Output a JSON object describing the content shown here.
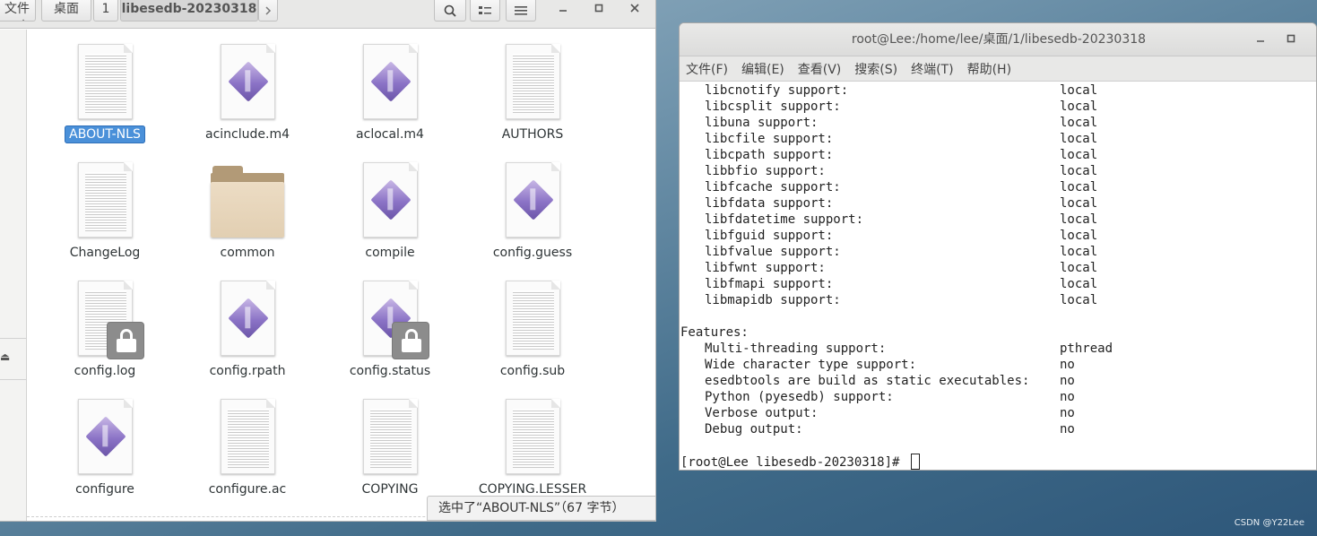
{
  "file_manager": {
    "breadcrumbs": [
      {
        "label": "文件夹"
      },
      {
        "label": "桌面"
      },
      {
        "label": "1"
      },
      {
        "label": "libesedb-20230318"
      }
    ],
    "items": [
      {
        "name": "ABOUT-NLS",
        "type": "text",
        "selected": true
      },
      {
        "name": "acinclude.m4",
        "type": "script"
      },
      {
        "name": "aclocal.m4",
        "type": "script"
      },
      {
        "name": "AUTHORS",
        "type": "text"
      },
      {
        "name": "ChangeLog",
        "type": "text"
      },
      {
        "name": "common",
        "type": "folder"
      },
      {
        "name": "compile",
        "type": "script"
      },
      {
        "name": "config.guess",
        "type": "script"
      },
      {
        "name": "config.log",
        "type": "text",
        "locked": true
      },
      {
        "name": "config.rpath",
        "type": "script"
      },
      {
        "name": "config.status",
        "type": "script",
        "locked": true
      },
      {
        "name": "config.sub",
        "type": "text"
      },
      {
        "name": "configure",
        "type": "script"
      },
      {
        "name": "configure.ac",
        "type": "text"
      },
      {
        "name": "COPYING",
        "type": "text"
      },
      {
        "name": "COPYING.LESSER",
        "type": "text"
      }
    ],
    "status": "选中了“ABOUT-NLS”（67 字节）"
  },
  "terminal": {
    "title": "root@Lee:/home/lee/桌面/1/libesedb-20230318",
    "menu": [
      "文件(F)",
      "编辑(E)",
      "查看(V)",
      "搜索(S)",
      "终端(T)",
      "帮助(H)"
    ],
    "lines": [
      {
        "key": "libcnotify support:",
        "value": "local"
      },
      {
        "key": "libcsplit support:",
        "value": "local"
      },
      {
        "key": "libuna support:",
        "value": "local"
      },
      {
        "key": "libcfile support:",
        "value": "local"
      },
      {
        "key": "libcpath support:",
        "value": "local"
      },
      {
        "key": "libbfio support:",
        "value": "local"
      },
      {
        "key": "libfcache support:",
        "value": "local"
      },
      {
        "key": "libfdata support:",
        "value": "local"
      },
      {
        "key": "libfdatetime support:",
        "value": "local"
      },
      {
        "key": "libfguid support:",
        "value": "local"
      },
      {
        "key": "libfvalue support:",
        "value": "local"
      },
      {
        "key": "libfwnt support:",
        "value": "local"
      },
      {
        "key": "libfmapi support:",
        "value": "local"
      },
      {
        "key": "libmapidb support:",
        "value": "local"
      }
    ],
    "features_heading": "Features:",
    "features": [
      {
        "key": "Multi-threading support:",
        "value": "pthread"
      },
      {
        "key": "Wide character type support:",
        "value": "no"
      },
      {
        "key": "esedbtools are build as static executables:",
        "value": "no"
      },
      {
        "key": "Python (pyesedb) support:",
        "value": "no"
      },
      {
        "key": "Verbose output:",
        "value": "no"
      },
      {
        "key": "Debug output:",
        "value": "no"
      }
    ],
    "prompt": "[root@Lee libesedb-20230318]# "
  },
  "watermark": "CSDN @Y22Lee"
}
